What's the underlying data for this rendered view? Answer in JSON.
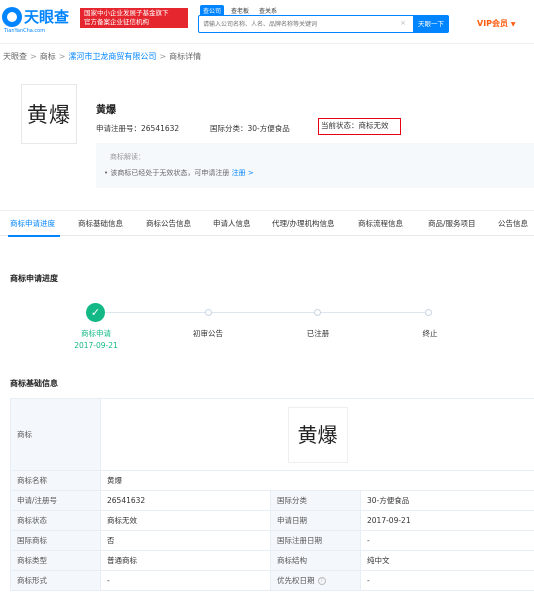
{
  "header": {
    "logo_text": "天眼查",
    "logo_sub": "TianYanCha.com",
    "banner_line1": "国家中小企业发展子基金旗下",
    "banner_line2": "官方备案企业征信机构",
    "search_tabs": [
      "查公司",
      "查老板",
      "查关系"
    ],
    "search_placeholder": "请输入公司名称、人名、品牌名称等关键词",
    "search_clear": "×",
    "search_button": "天眼一下",
    "vip_label": "VIP会员",
    "vip_caret": "▼"
  },
  "breadcrumb": {
    "home": "天眼查",
    "trademark": "商标",
    "company": "漯河市卫龙商贸有限公司",
    "current": "商标详情",
    "sep": ">"
  },
  "trademark": {
    "image_text": "黄爆",
    "name": "黄爆",
    "reg_no": "申请注册号：26541632",
    "intl_class": "国际分类：30-方便食品",
    "status": "当前状态：商标无效"
  },
  "interpretation": {
    "title": "商标解读：",
    "text": "• 该商标已经处于无效状态，可申请注册",
    "link": "注册 >"
  },
  "tabs": [
    "商标申请进度",
    "商标基础信息",
    "商标公告信息",
    "申请人信息",
    "代理/办理机构信息",
    "商标流程信息",
    "商品/服务项目",
    "公告信息"
  ],
  "progress": {
    "title": "商标申请进度",
    "steps": [
      {
        "label": "商标申请",
        "date": "2017-09-21",
        "done": true
      },
      {
        "label": "初审公告",
        "done": false
      },
      {
        "label": "已注册",
        "done": false
      },
      {
        "label": "终止",
        "done": false
      }
    ],
    "check": "✓"
  },
  "basic_info": {
    "title": "商标基础信息",
    "image_key": "商标",
    "image_text": "黄爆",
    "rows": [
      {
        "k1": "商标名称",
        "v1": "黄爆"
      },
      {
        "k1": "申请/注册号",
        "v1": "26541632",
        "k2": "国际分类",
        "v2": "30-方便食品"
      },
      {
        "k1": "商标状态",
        "v1": "商标无效",
        "k2": "申请日期",
        "v2": "2017-09-21"
      },
      {
        "k1": "国际商标",
        "v1": "否",
        "k2": "国际注册日期",
        "v2": "-"
      },
      {
        "k1": "商标类型",
        "v1": "普通商标",
        "k2": "商标结构",
        "v2": "纯中文"
      },
      {
        "k1": "商标形式",
        "v1": "-",
        "k2": "优先权日期",
        "v2": "-"
      }
    ],
    "help_icon": "?"
  },
  "colors": {
    "brand": "#0084ff",
    "danger": "#e60012",
    "success": "#12b886",
    "vip": "#ff5b0d"
  }
}
